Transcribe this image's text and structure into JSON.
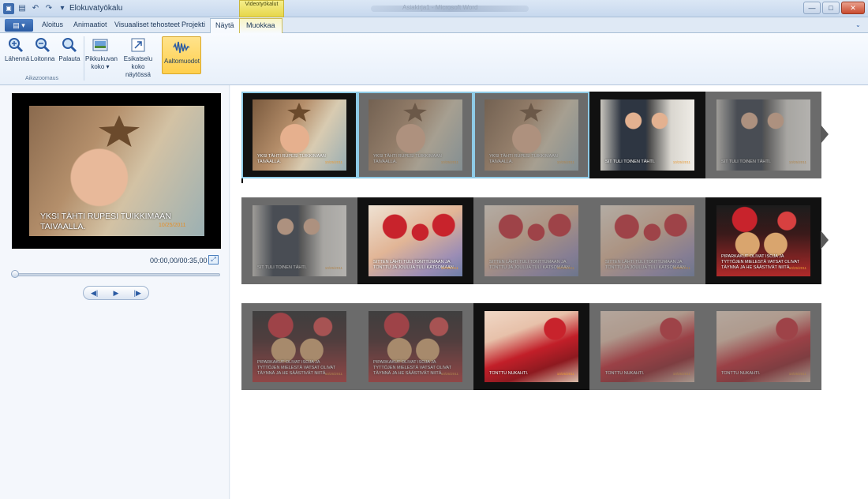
{
  "window": {
    "title": "Elokuvatyökalu",
    "context_group": "Videotyökalut",
    "background_title": "Asiakirja1 - Microsoft Word",
    "buttons": {
      "minimize": "—",
      "maximize": "□",
      "close": "✕"
    }
  },
  "ribbon": {
    "file_label": "▾",
    "tabs": [
      {
        "label": "Aloitus"
      },
      {
        "label": "Animaatiot"
      },
      {
        "label": "Visuaaliset tehosteet"
      },
      {
        "label": "Projekti"
      },
      {
        "label": "Näytä"
      },
      {
        "label": "Muokkaa"
      }
    ],
    "active_tab": "Näytä",
    "buttons": [
      {
        "label": "Lähennä",
        "icon": "zoom-in-icon"
      },
      {
        "label": "Loitonna",
        "icon": "zoom-out-icon"
      },
      {
        "label": "Palauta",
        "icon": "zoom-reset-icon"
      },
      {
        "label": "Pikkukuvan koko ▾",
        "icon": "thumbnail-size-icon"
      },
      {
        "label": "Esikatselu koko näytössä",
        "icon": "fullscreen-preview-icon"
      },
      {
        "label": "Aaltomuodot",
        "icon": "waveform-icon"
      }
    ],
    "group_label": "Aikazoomaus"
  },
  "preview": {
    "caption": "YKSI TÄHTI RUPESI TUIKKIMAAN TAIVAALLA.",
    "date": "10/25/2011",
    "timecode": "00:00,00/00:35,00"
  },
  "playback": {
    "prev": "◀|",
    "play": "▶",
    "next": "|▶"
  },
  "storyboard": {
    "rows": [
      {
        "frames": [
          {
            "caption": "YKSI TÄHTI RUPESI TUIKKIMAAN TAIVAALLA.",
            "date": "10/25/2011",
            "image": "boy-star",
            "style": "dark",
            "faded": false,
            "selected": true
          },
          {
            "caption": "YKSI TÄHTI RUPESI TUIKKIMAAN TAIVAALLA.",
            "date": "10/25/2011",
            "image": "boy-star",
            "style": "light",
            "faded": true,
            "selected": true
          },
          {
            "caption": "YKSI TÄHTI RUPESI TUIKKIMAAN TAIVAALLA.",
            "date": "10/25/2011",
            "image": "boy-star",
            "style": "light",
            "faded": true,
            "selected": true
          },
          {
            "caption": "SIT TULI TOINEN TÄHTI.",
            "date": "10/25/2011",
            "image": "two-boys",
            "style": "dark",
            "faded": false,
            "selected": false
          },
          {
            "caption": "SIT TULI TOINEN TÄHTI.",
            "date": "10/25/2011",
            "image": "two-boys",
            "style": "light",
            "faded": true,
            "selected": false
          }
        ]
      },
      {
        "frames": [
          {
            "caption": "SIT TULI TOINEN TÄHTI.",
            "date": "10/25/2011",
            "image": "two-boys",
            "style": "light",
            "faded": true,
            "selected": false
          },
          {
            "caption": "SITTEN LÄHTI TULI TONTTUMAAN JA TONTTU JA JOULUA TULI KATSOMAAN.",
            "date": "10/25/2011",
            "image": "santa-kids",
            "style": "dark",
            "faded": false,
            "selected": false
          },
          {
            "caption": "SITTEN LÄHTI TULI TONTTUMAAN JA TONTTU JA JOULUA TULI KATSOMAAN.",
            "date": "10/25/2011",
            "image": "santa-kids",
            "style": "light",
            "faded": true,
            "selected": false
          },
          {
            "caption": "SITTEN LÄHTI TULI TONTTUMAAN JA TONTTU JA JOULUA TULI KATSOMAAN.",
            "date": "10/25/2011",
            "image": "santa-kids",
            "style": "light",
            "faded": true,
            "selected": false
          },
          {
            "caption": "PIPARKAKUT OLIVAT ISOJA JA TYTTÖJEN MIELESTÄ VATSAT OLIVAT TÄYNNÄ JA HE SÄÄSTIVÄT NIITÄ.",
            "date": "10/25/2011",
            "image": "heart-cookies",
            "style": "dark",
            "faded": false,
            "selected": false
          }
        ]
      },
      {
        "frames": [
          {
            "caption": "PIPARKAKUT OLIVAT ISOJA JA TYTTÖJEN MIELESTÄ VATSAT OLIVAT TÄYNNÄ JA HE SÄÄSTIVÄT NIITÄ.",
            "date": "10/25/2011",
            "image": "heart-cookies",
            "style": "light",
            "faded": true,
            "selected": false
          },
          {
            "caption": "PIPARKAKUT OLIVAT ISOJA JA TYTTÖJEN MIELESTÄ VATSAT OLIVAT TÄYNNÄ JA HE SÄÄSTIVÄT NIITÄ.",
            "date": "10/25/2011",
            "image": "heart-cookies",
            "style": "light",
            "faded": true,
            "selected": false
          },
          {
            "caption": "TONTTU NUKAHTI.",
            "date": "10/25/2011",
            "image": "red-elf",
            "style": "dark",
            "faded": false,
            "selected": false
          },
          {
            "caption": "TONTTU NUKAHTI.",
            "date": "10/25/2011",
            "image": "red-elf",
            "style": "light",
            "faded": true,
            "selected": false
          },
          {
            "caption": "TONTTU NUKAHTI.",
            "date": "10/25/2011",
            "image": "red-elf",
            "style": "light",
            "faded": true,
            "selected": false
          }
        ]
      }
    ]
  }
}
